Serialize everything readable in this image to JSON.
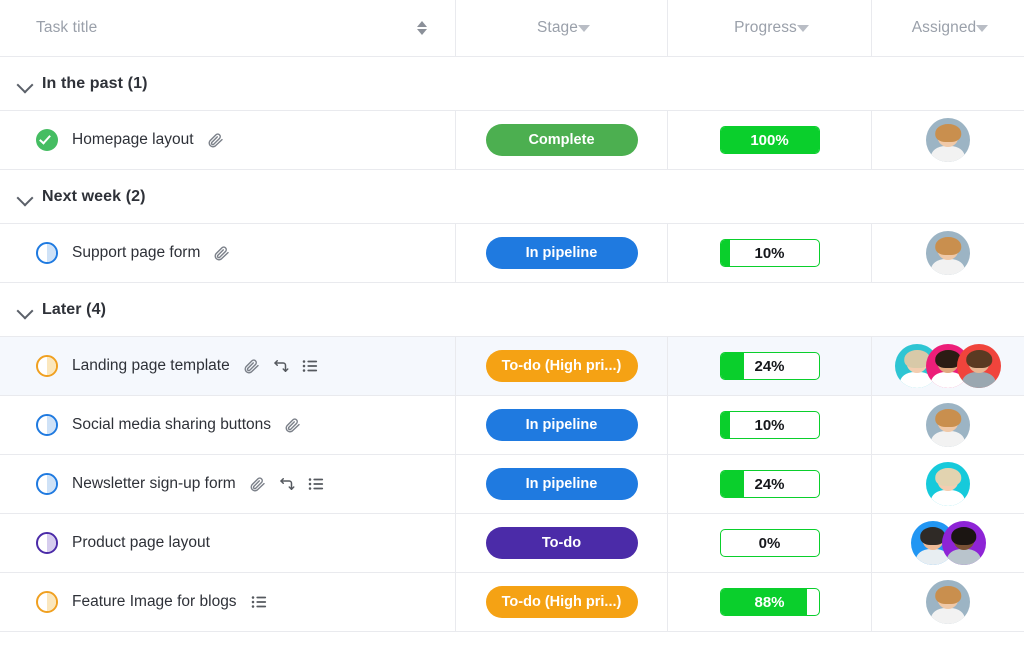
{
  "columns": [
    {
      "label": "Task title",
      "icon": "sort-icon"
    },
    {
      "label": "Stage",
      "icon": "chevron-down-icon"
    },
    {
      "label": "Progress",
      "icon": "chevron-down-icon"
    },
    {
      "label": "Assigned",
      "icon": "chevron-down-icon"
    }
  ],
  "groups": [
    {
      "label": "In the past (1)"
    },
    {
      "label": "Next week (2)"
    },
    {
      "label": "Later (4)"
    }
  ],
  "rows": [
    {
      "title": "Homepage layout",
      "status": "complete",
      "icons": [
        "attachment-icon"
      ],
      "stage": "Complete",
      "stage_color": "#4CAF50",
      "progress": "100%",
      "progress_value": 100,
      "assignees": [
        {
          "bg": "#9cb4c4",
          "hair": "#c98f4e",
          "skin": "#f0c9a8",
          "shirt": "#f2f2f2"
        }
      ],
      "highlighted": false
    },
    {
      "title": "Support page form",
      "status": "in-pipeline",
      "icons": [
        "attachment-icon"
      ],
      "stage": "In pipeline",
      "stage_color": "#1f7ae0",
      "progress": "10%",
      "progress_value": 10,
      "assignees": [
        {
          "bg": "#9cb4c4",
          "hair": "#c98f4e",
          "skin": "#f0c9a8",
          "shirt": "#f2f2f2"
        }
      ],
      "highlighted": false
    },
    {
      "title": "Landing page template",
      "status": "todo-high",
      "icons": [
        "attachment-icon",
        "repeat-icon",
        "checklist-icon"
      ],
      "stage": "To-do (High pri...)",
      "stage_color": "#F5A214",
      "progress": "24%",
      "progress_value": 24,
      "assignees": [
        {
          "bg": "#2ec5d3",
          "hair": "#d8c9a8",
          "skin": "#f3cdb0",
          "shirt": "#ffffff"
        },
        {
          "bg": "#ec1e79",
          "hair": "#2b1c14",
          "skin": "#e0a87e",
          "shirt": "#ffffff"
        },
        {
          "bg": "#f0443c",
          "hair": "#5a3a22",
          "skin": "#e8b692",
          "shirt": "#9aa7b0"
        }
      ],
      "highlighted": true
    },
    {
      "title": "Social media sharing buttons",
      "status": "in-pipeline",
      "icons": [
        "attachment-icon"
      ],
      "stage": "In pipeline",
      "stage_color": "#1f7ae0",
      "progress": "10%",
      "progress_value": 10,
      "assignees": [
        {
          "bg": "#9cb4c4",
          "hair": "#c98f4e",
          "skin": "#f0c9a8",
          "shirt": "#f2f2f2"
        }
      ],
      "highlighted": false
    },
    {
      "title": "Newsletter sign-up form",
      "status": "in-pipeline",
      "icons": [
        "attachment-icon",
        "repeat-icon",
        "checklist-icon"
      ],
      "stage": "In pipeline",
      "stage_color": "#1f7ae0",
      "progress": "24%",
      "progress_value": 24,
      "assignees": [
        {
          "bg": "#16cadb",
          "hair": "#e2d3b0",
          "skin": "#f3cdb0",
          "shirt": "#ffffff"
        }
      ],
      "highlighted": false
    },
    {
      "title": "Product page layout",
      "status": "todo",
      "icons": [],
      "stage": "To-do",
      "stage_color": "#4B2BA8",
      "progress": "0%",
      "progress_value": 0,
      "assignees": [
        {
          "bg": "#2196f3",
          "hair": "#2f2a26",
          "skin": "#eebb97",
          "shirt": "#e8eef2"
        },
        {
          "bg": "#8e24d6",
          "hair": "#1b1512",
          "skin": "#7a5135",
          "shirt": "#b9c4cc"
        }
      ],
      "highlighted": false
    },
    {
      "title": "Feature Image for blogs",
      "status": "todo-high",
      "icons": [
        "checklist-icon"
      ],
      "stage": "To-do (High pri...)",
      "stage_color": "#F5A214",
      "progress": "88%",
      "progress_value": 88,
      "assignees": [
        {
          "bg": "#9cb4c4",
          "hair": "#c98f4e",
          "skin": "#f0c9a8",
          "shirt": "#f2f2f2"
        }
      ],
      "highlighted": false
    }
  ],
  "layout": {
    "group_row_after": [
      0,
      1,
      3
    ]
  },
  "colors": {
    "progress_green": "#0ACF2C",
    "complete_green": "#4CAF50",
    "pipeline_blue": "#1f7ae0",
    "todo_purple": "#4B2BA8",
    "high_orange": "#F5A214",
    "row_highlight": "#f5f8fd",
    "border": "#e9eaee"
  }
}
